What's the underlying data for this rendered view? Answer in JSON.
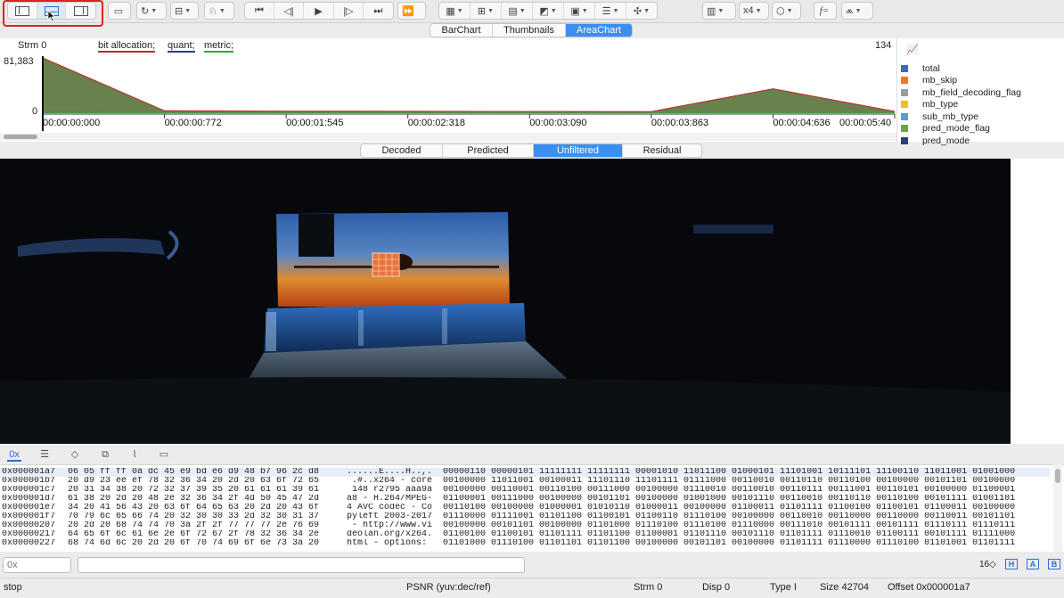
{
  "toolbar": {
    "zoom_label": "x4"
  },
  "chart_tabs": [
    "BarChart",
    "Thumbnails",
    "AreaChart"
  ],
  "chart": {
    "stream_label": "Strm 0",
    "series_labels": [
      "bit allocation;",
      "quant;",
      "metric;"
    ],
    "frame_count": "134",
    "y_max_label": "81,383",
    "y_min_label": "0",
    "time_ticks": [
      "00:00:00:000",
      "00:00:00:772",
      "00:00:01:545",
      "00:00:02:318",
      "00:00:03:090",
      "00:00:03:863",
      "00:00:04:636",
      "00:00:05:40"
    ]
  },
  "chart_data": {
    "type": "area",
    "title": "",
    "xlabel": "",
    "ylabel": "",
    "ylim": [
      0,
      81383
    ],
    "categories": [
      "00:00:00:000",
      "00:00:00:772",
      "00:00:01:545",
      "00:00:02:318",
      "00:00:03:090",
      "00:00:03:863",
      "00:00:04:636",
      "00:00:05:40"
    ],
    "series": [
      {
        "name": "bit allocation;",
        "values": [
          81383,
          3500,
          3000,
          2800,
          2500,
          2400,
          36000,
          2600
        ]
      },
      {
        "name": "quant;",
        "values": [
          800,
          700,
          700,
          700,
          700,
          700,
          700,
          700
        ]
      },
      {
        "name": "metric;",
        "values": [
          600,
          600,
          600,
          600,
          600,
          600,
          600,
          600
        ]
      }
    ]
  },
  "legend": {
    "chart_type_icon": "line-chart-icon",
    "items": [
      {
        "label": "total",
        "color": "#3f66c7"
      },
      {
        "label": "mb_skip",
        "color": "#e8772b"
      },
      {
        "label": "mb_field_decoding_flag",
        "color": "#9b9b9b"
      },
      {
        "label": "mb_type",
        "color": "#f0c020"
      },
      {
        "label": "sub_mb_type",
        "color": "#5b9bd5"
      },
      {
        "label": "pred_mode_flag",
        "color": "#6aa83f"
      },
      {
        "label": "pred_mode",
        "color": "#2a3f7a"
      }
    ]
  },
  "view_tabs": [
    "Decoded",
    "Predicted",
    "Unfiltered",
    "Residual"
  ],
  "hex": {
    "rows": [
      {
        "addr": "0x000001a7",
        "bytes": "06 05 ff ff 0a dc 45 e9 bd e6 d9 48 b7 96 2c d8",
        "ascii": "......E....H..,.",
        "bits": "00000110 00000101 11111111 11111111 00001010 11011100 01000101 11101001 10111101 11100110 11011001 01001000"
      },
      {
        "addr": "0x000001b7",
        "bytes": "20 d9 23 ee ef 78 32 36 34 20 2d 20 63 6f 72 65",
        "ascii": " .#..x264 - core",
        "bits": "00100000 11011001 00100011 11101110 11101111 01111000 00110010 00110110 00110100 00100000 00101101 00100000"
      },
      {
        "addr": "0x000001c7",
        "bytes": "20 31 34 38 20 72 32 37 39 35 20 61 61 61 39 61",
        "ascii": " 148 r2795 aaa9a",
        "bits": "00100000 00110001 00110100 00111000 00100000 01110010 00110010 00110111 00111001 00110101 00100000 01100001"
      },
      {
        "addr": "0x000001d7",
        "bytes": "61 38 20 2d 20 48 2e 32 36 34 2f 4d 50 45 47 2d",
        "ascii": "a8 - H.264/MPEG-",
        "bits": "01100001 00111000 00100000 00101101 00100000 01001000 00101110 00110010 00110110 00110100 00101111 01001101"
      },
      {
        "addr": "0x000001e7",
        "bytes": "34 20 41 56 43 20 63 6f 64 65 63 20 2d 20 43 6f",
        "ascii": "4 AVC codec - Co",
        "bits": "00110100 00100000 01000001 01010110 01000011 00100000 01100011 01101111 01100100 01100101 01100011 00100000"
      },
      {
        "addr": "0x000001f7",
        "bytes": "70 79 6c 65 66 74 20 32 30 30 33 2d 32 30 31 37",
        "ascii": "pyleft 2003-2017",
        "bits": "01110000 01111001 01101100 01100101 01100110 01110100 00100000 00110010 00110000 00110000 00110011 00101101"
      },
      {
        "addr": "0x00000207",
        "bytes": "20 2d 20 68 74 74 70 3a 2f 2f 77 77 77 2e 76 69",
        "ascii": " - http://www.vi",
        "bits": "00100000 00101101 00100000 01101000 01110100 01110100 01110000 00111010 00101111 00101111 01110111 01110111"
      },
      {
        "addr": "0x00000217",
        "bytes": "64 65 6f 6c 61 6e 2e 6f 72 67 2f 78 32 36 34 2e",
        "ascii": "deolan.org/x264.",
        "bits": "01100100 01100101 01101111 01101100 01100001 01101110 00101110 01101111 01110010 01100111 00101111 01111000"
      },
      {
        "addr": "0x00000227",
        "bytes": "68 74 6d 6c 20 2d 20 6f 70 74 69 6f 6e 73 3a 20",
        "ascii": "html - options: ",
        "bits": "01101000 01110100 01101101 01101100 00100000 00101101 00100000 01101111 01110000 01110100 01101001 01101111"
      }
    ]
  },
  "inputs": {
    "offset_placeholder": "0x",
    "search_placeholder": "",
    "radix": "16",
    "radix_caret": "◇",
    "mode_labels": [
      "H",
      "A",
      "B"
    ]
  },
  "status": {
    "left": "stop",
    "psnr": "PSNR (yuv:dec/ref)",
    "strm": "Strm 0",
    "disp": "Disp 0",
    "type": "Type I",
    "size": "Size 42704",
    "offset": "Offset 0x000001a7"
  }
}
